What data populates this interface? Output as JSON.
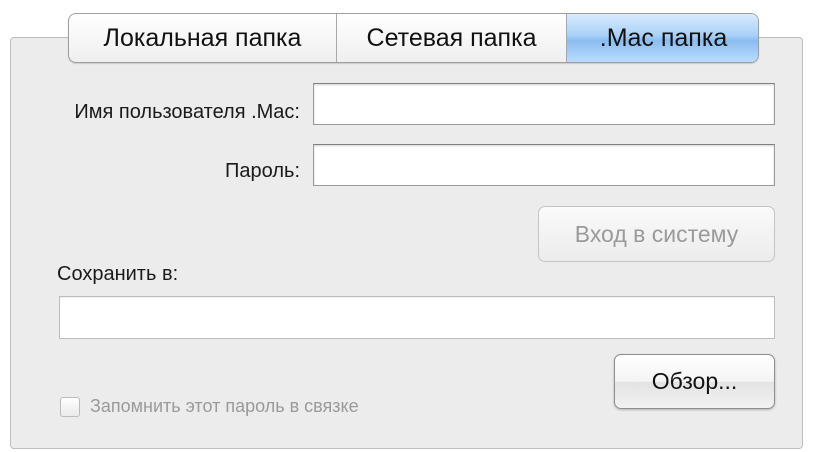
{
  "tabs": [
    {
      "label": "Локальная папка",
      "selected": false
    },
    {
      "label": "Сетевая папка",
      "selected": false
    },
    {
      "label": ".Mac папка",
      "selected": true
    }
  ],
  "form": {
    "username_label": "Имя пользователя .Mac:",
    "username_value": "",
    "password_label": "Пароль:",
    "password_value": "",
    "login_button": "Вход в систему",
    "save_label": "Сохранить в:",
    "save_value": "",
    "browse_button": "Обзор...",
    "remember_label": "Запомнить этот пароль в связке",
    "remember_checked": false
  },
  "colors": {
    "selected_tab": "#a9d0f7",
    "panel_background": "#ececec",
    "disabled_text": "#9a9a9a"
  }
}
